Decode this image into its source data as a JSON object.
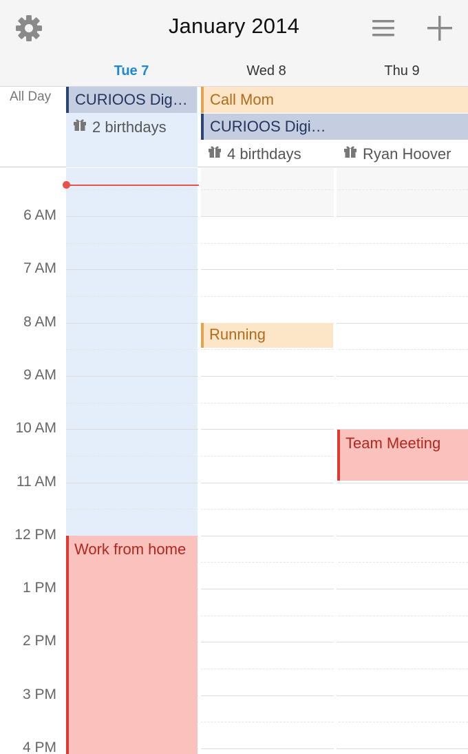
{
  "header": {
    "title": "January 2014",
    "days": [
      {
        "label": "Tue 7",
        "today": true
      },
      {
        "label": "Wed 8",
        "today": false
      },
      {
        "label": "Thu 9",
        "today": false
      }
    ]
  },
  "all_day": {
    "label": "All Day",
    "events": [
      {
        "title": "CURIOOS Dig…",
        "day": "Tue 7"
      },
      {
        "title": "Call Mom",
        "day": "Wed 8"
      },
      {
        "title": "CURIOOS Digi…",
        "day": "Wed 8"
      }
    ],
    "birthdays": [
      {
        "text": "2 birthdays",
        "day": "Tue 7"
      },
      {
        "text": "4 birthdays",
        "day": "Wed 8"
      },
      {
        "text": "Ryan Hoover",
        "day": "Thu 9"
      }
    ]
  },
  "timeline": {
    "hours": [
      "6 AM",
      "7 AM",
      "8 AM",
      "9 AM",
      "10 AM",
      "11 AM",
      "12 PM",
      "1 PM",
      "2 PM",
      "3 PM",
      "4 PM"
    ],
    "events": [
      {
        "title": "Running",
        "day": "Wed 8"
      },
      {
        "title": "Team Meeting",
        "day": "Thu 9"
      },
      {
        "title": "Work from home",
        "day": "Tue 7"
      }
    ]
  },
  "colors": {
    "today_accent": "#1e88d6",
    "now_indicator": "#e8524a",
    "blue_event": "#c4cee0",
    "orange_event": "#fde6c8",
    "red_event": "#fbc2bd"
  }
}
